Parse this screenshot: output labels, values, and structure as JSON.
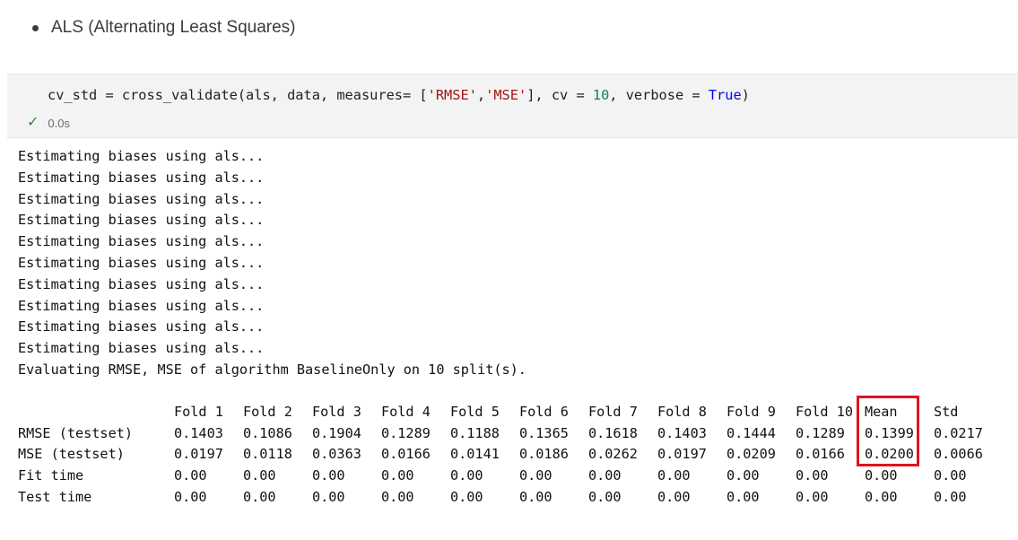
{
  "markdown": {
    "bullet_text": "ALS (Alternating Least Squares)"
  },
  "cell": {
    "code": {
      "p1": "cv_std = cross_validate(als, data, measures= [",
      "s1": "'RMSE'",
      "p2": ",",
      "s2": "'MSE'",
      "p3": "], cv = ",
      "n1": "10",
      "p4": ", verbose = ",
      "k1": "True",
      "p5": ")"
    },
    "status_icon": "check-icon",
    "exec_time": "0.0s"
  },
  "output": {
    "lines": [
      "Estimating biases using als...",
      "Estimating biases using als...",
      "Estimating biases using als...",
      "Estimating biases using als...",
      "Estimating biases using als...",
      "Estimating biases using als...",
      "Estimating biases using als...",
      "Estimating biases using als...",
      "Estimating biases using als...",
      "Estimating biases using als...",
      "Evaluating RMSE, MSE of algorithm BaselineOnly on 10 split(s)."
    ],
    "table": {
      "headers": [
        "Fold 1",
        "Fold 2",
        "Fold 3",
        "Fold 4",
        "Fold 5",
        "Fold 6",
        "Fold 7",
        "Fold 8",
        "Fold 9",
        "Fold 10",
        "Mean",
        "Std"
      ],
      "rows": [
        {
          "label": "RMSE (testset)",
          "values": [
            "0.1403",
            "0.1086",
            "0.1904",
            "0.1289",
            "0.1188",
            "0.1365",
            "0.1618",
            "0.1403",
            "0.1444",
            "0.1289",
            "0.1399",
            "0.0217"
          ]
        },
        {
          "label": "MSE (testset)",
          "values": [
            "0.0197",
            "0.0118",
            "0.0363",
            "0.0166",
            "0.0141",
            "0.0186",
            "0.0262",
            "0.0197",
            "0.0209",
            "0.0166",
            "0.0200",
            "0.0066"
          ]
        },
        {
          "label": "Fit time",
          "values": [
            "0.00",
            "0.00",
            "0.00",
            "0.00",
            "0.00",
            "0.00",
            "0.00",
            "0.00",
            "0.00",
            "0.00",
            "0.00",
            "0.00"
          ]
        },
        {
          "label": "Test time",
          "values": [
            "0.00",
            "0.00",
            "0.00",
            "0.00",
            "0.00",
            "0.00",
            "0.00",
            "0.00",
            "0.00",
            "0.00",
            "0.00",
            "0.00"
          ]
        }
      ]
    },
    "highlight_color": "#e0141e"
  }
}
